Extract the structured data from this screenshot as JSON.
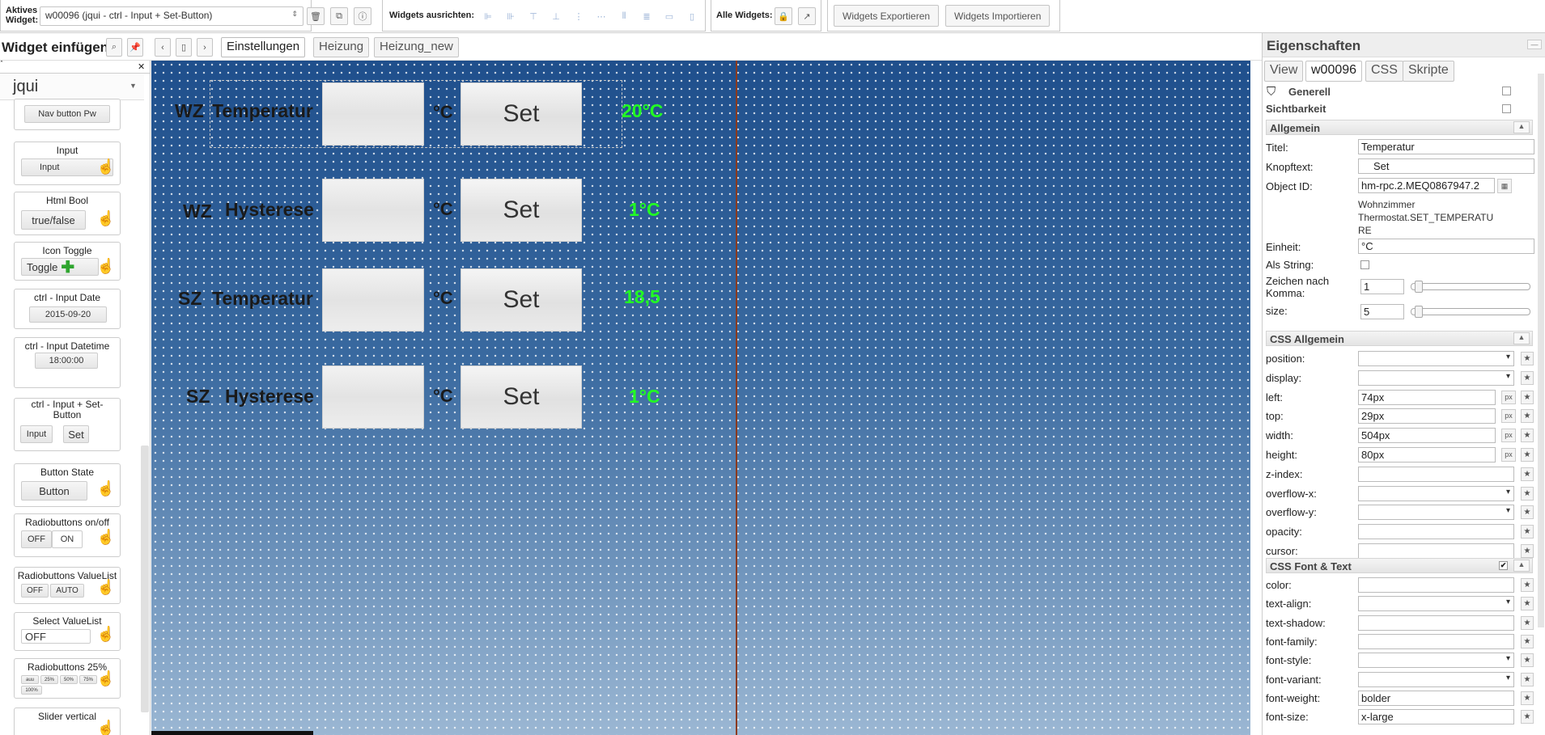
{
  "toolbar": {
    "active_widget_label": "Aktives Widget:",
    "active_widget_value": "w00096 (jqui - ctrl - Input + Set-Button)",
    "align_label": "Widgets ausrichten:",
    "all_widgets_label": "Alle Widgets:",
    "export_label": "Widgets Exportieren",
    "import_label": "Widgets Importieren"
  },
  "bar2": {
    "insert_title": "Widget einfügen",
    "tabs": [
      "Einstellungen",
      "Heizung",
      "Heizung_new"
    ]
  },
  "palette": {
    "filter_close": "✕",
    "set_name": "jqui",
    "widgets": [
      {
        "title": "",
        "button": "Nav button Pw"
      },
      {
        "title": "Input",
        "button": "Input"
      },
      {
        "title": "Html Bool",
        "button": "true/false"
      },
      {
        "title": "Icon Toggle",
        "button": "Toggle"
      },
      {
        "title": "ctrl - Input Date",
        "button": "2015-09-20"
      },
      {
        "title": "ctrl - Input Datetime",
        "button": "18:00:00"
      },
      {
        "title": "ctrl - Input + Set-Button",
        "button": "Input",
        "button2": "Set"
      },
      {
        "title": "Button State",
        "button": "Button"
      },
      {
        "title": "Radiobuttons on/off",
        "button": "OFF",
        "button2": "ON"
      },
      {
        "title": "Radiobuttons ValueList",
        "button": "OFF",
        "button2": "AUTO"
      },
      {
        "title": "Select ValueList",
        "button": "OFF"
      },
      {
        "title": "Radiobuttons 25%",
        "opts": [
          "auu",
          "25%",
          "50%",
          "75%",
          "100%"
        ]
      },
      {
        "title": "Slider vertical"
      }
    ]
  },
  "canvas": {
    "rows": [
      {
        "room": "WZ",
        "label": "Temperatur",
        "unit": "°C",
        "button": "Set",
        "value": "20°C"
      },
      {
        "room": "WZ",
        "label": "Hysterese",
        "unit": "°C",
        "button": "Set",
        "value": "1°C"
      },
      {
        "room": "SZ",
        "label": "Temperatur",
        "unit": "°C",
        "button": "Set",
        "value": "18,5"
      },
      {
        "room": "SZ",
        "label": "Hysterese",
        "unit": "°C",
        "button": "Set",
        "value": "1°C"
      }
    ],
    "value_color": "#22ff22"
  },
  "props": {
    "title": "Eigenschaften",
    "tabs": [
      "View",
      "w00096",
      "CSS",
      "Skripte"
    ],
    "filter_label": "Generell",
    "visibility_label": "Sichtbarkeit",
    "general_section": "Allgemein",
    "fields": {
      "title_label": "Titel:",
      "title_value": "Temperatur",
      "btn_label": "Knopftext:",
      "btn_value": "Set",
      "oid_label": "Object ID:",
      "oid_value": "hm-rpc.2.MEQ0867947.2",
      "oid_desc_1": "Wohnzimmer",
      "oid_desc_2": "Thermostat.SET_TEMPERATU",
      "oid_desc_3": "RE",
      "unit_label": "Einheit:",
      "unit_value": "°C",
      "asstring_label": "Als String:",
      "digits_label_1": "Zeichen nach",
      "digits_label_2": "Komma:",
      "digits_value": "1",
      "size_label": "size:",
      "size_value": "5"
    },
    "css_general": "CSS Allgemein",
    "css_rows": [
      {
        "label": "position:",
        "value": "",
        "select": true
      },
      {
        "label": "display:",
        "value": "",
        "select": true
      },
      {
        "label": "left:",
        "value": "74px",
        "px": true
      },
      {
        "label": "top:",
        "value": "29px",
        "px": true
      },
      {
        "label": "width:",
        "value": "504px",
        "px": true
      },
      {
        "label": "height:",
        "value": "80px",
        "px": true
      },
      {
        "label": "z-index:",
        "value": ""
      },
      {
        "label": "overflow-x:",
        "value": "",
        "select": true
      },
      {
        "label": "overflow-y:",
        "value": "",
        "select": true
      },
      {
        "label": "opacity:",
        "value": ""
      },
      {
        "label": "cursor:",
        "value": ""
      }
    ],
    "css_font": "CSS Font & Text",
    "font_rows": [
      {
        "label": "color:",
        "value": ""
      },
      {
        "label": "text-align:",
        "value": "",
        "select": true
      },
      {
        "label": "text-shadow:",
        "value": ""
      },
      {
        "label": "font-family:",
        "value": ""
      },
      {
        "label": "font-style:",
        "value": "",
        "select": true
      },
      {
        "label": "font-variant:",
        "value": "",
        "select": true
      },
      {
        "label": "font-weight:",
        "value": "bolder"
      },
      {
        "label": "font-size:",
        "value": "x-large"
      }
    ]
  }
}
